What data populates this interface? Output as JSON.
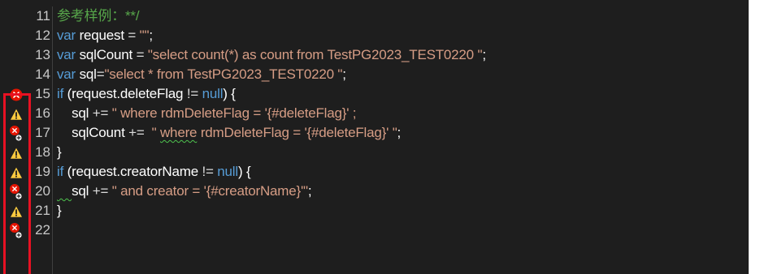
{
  "colors": {
    "background": "#1e1e1e",
    "keyword": "#569cd6",
    "identifier": "#ffffff",
    "string": "#d69d85",
    "comment": "#57a64a",
    "highlight_box": "#e81123",
    "error": "#e51400",
    "warning": "#fcca3f"
  },
  "gutter_icons": {
    "error": "error-icon",
    "warning": "warning-icon",
    "error_fix": "error-with-fix-icon"
  },
  "lines": [
    {
      "num": "11",
      "icon": "",
      "t": [
        "参考样例：**/"
      ]
    },
    {
      "num": "12",
      "icon": "",
      "t": [
        "var",
        " ",
        "request",
        " = ",
        "\"\"",
        ";"
      ]
    },
    {
      "num": "13",
      "icon": "",
      "t": [
        "var",
        " ",
        "sqlCount",
        " = ",
        "\"select count(*) as count from TestPG2023_TEST0220 \"",
        ";"
      ]
    },
    {
      "num": "14",
      "icon": "",
      "t": [
        "var",
        " ",
        "sql",
        "=",
        "\"select * from TestPG2023_TEST0220 \"",
        ";"
      ]
    },
    {
      "num": "15",
      "icon": "error",
      "t": [
        "if",
        " (",
        "request.deleteFlag",
        " != ",
        "null",
        ") {"
      ]
    },
    {
      "num": "16",
      "icon": "warning",
      "t": [
        "    ",
        "sql",
        " += ",
        "\" where rdmDeleteFlag = '{#deleteFlag}' ;"
      ]
    },
    {
      "num": "17",
      "icon": "error_fix",
      "t": [
        "    ",
        "sqlCount",
        " +=  ",
        "\" ",
        "where",
        " rdmDeleteFlag = '{#deleteFlag}' \"",
        ";"
      ]
    },
    {
      "num": "18",
      "icon": "warning",
      "t": [
        "}"
      ]
    },
    {
      "num": "19",
      "icon": "warning",
      "t": [
        "if",
        " (",
        "request.creatorName",
        " != ",
        "null",
        ") {"
      ]
    },
    {
      "num": "20",
      "icon": "error_fix",
      "t": [
        "    ",
        "sql",
        " += ",
        "\" and creator = '{#creatorName}'\"",
        ";"
      ]
    },
    {
      "num": "21",
      "icon": "warning",
      "t": [
        "}"
      ]
    },
    {
      "num": "22",
      "icon": "error_fix",
      "t": [
        ""
      ]
    }
  ]
}
